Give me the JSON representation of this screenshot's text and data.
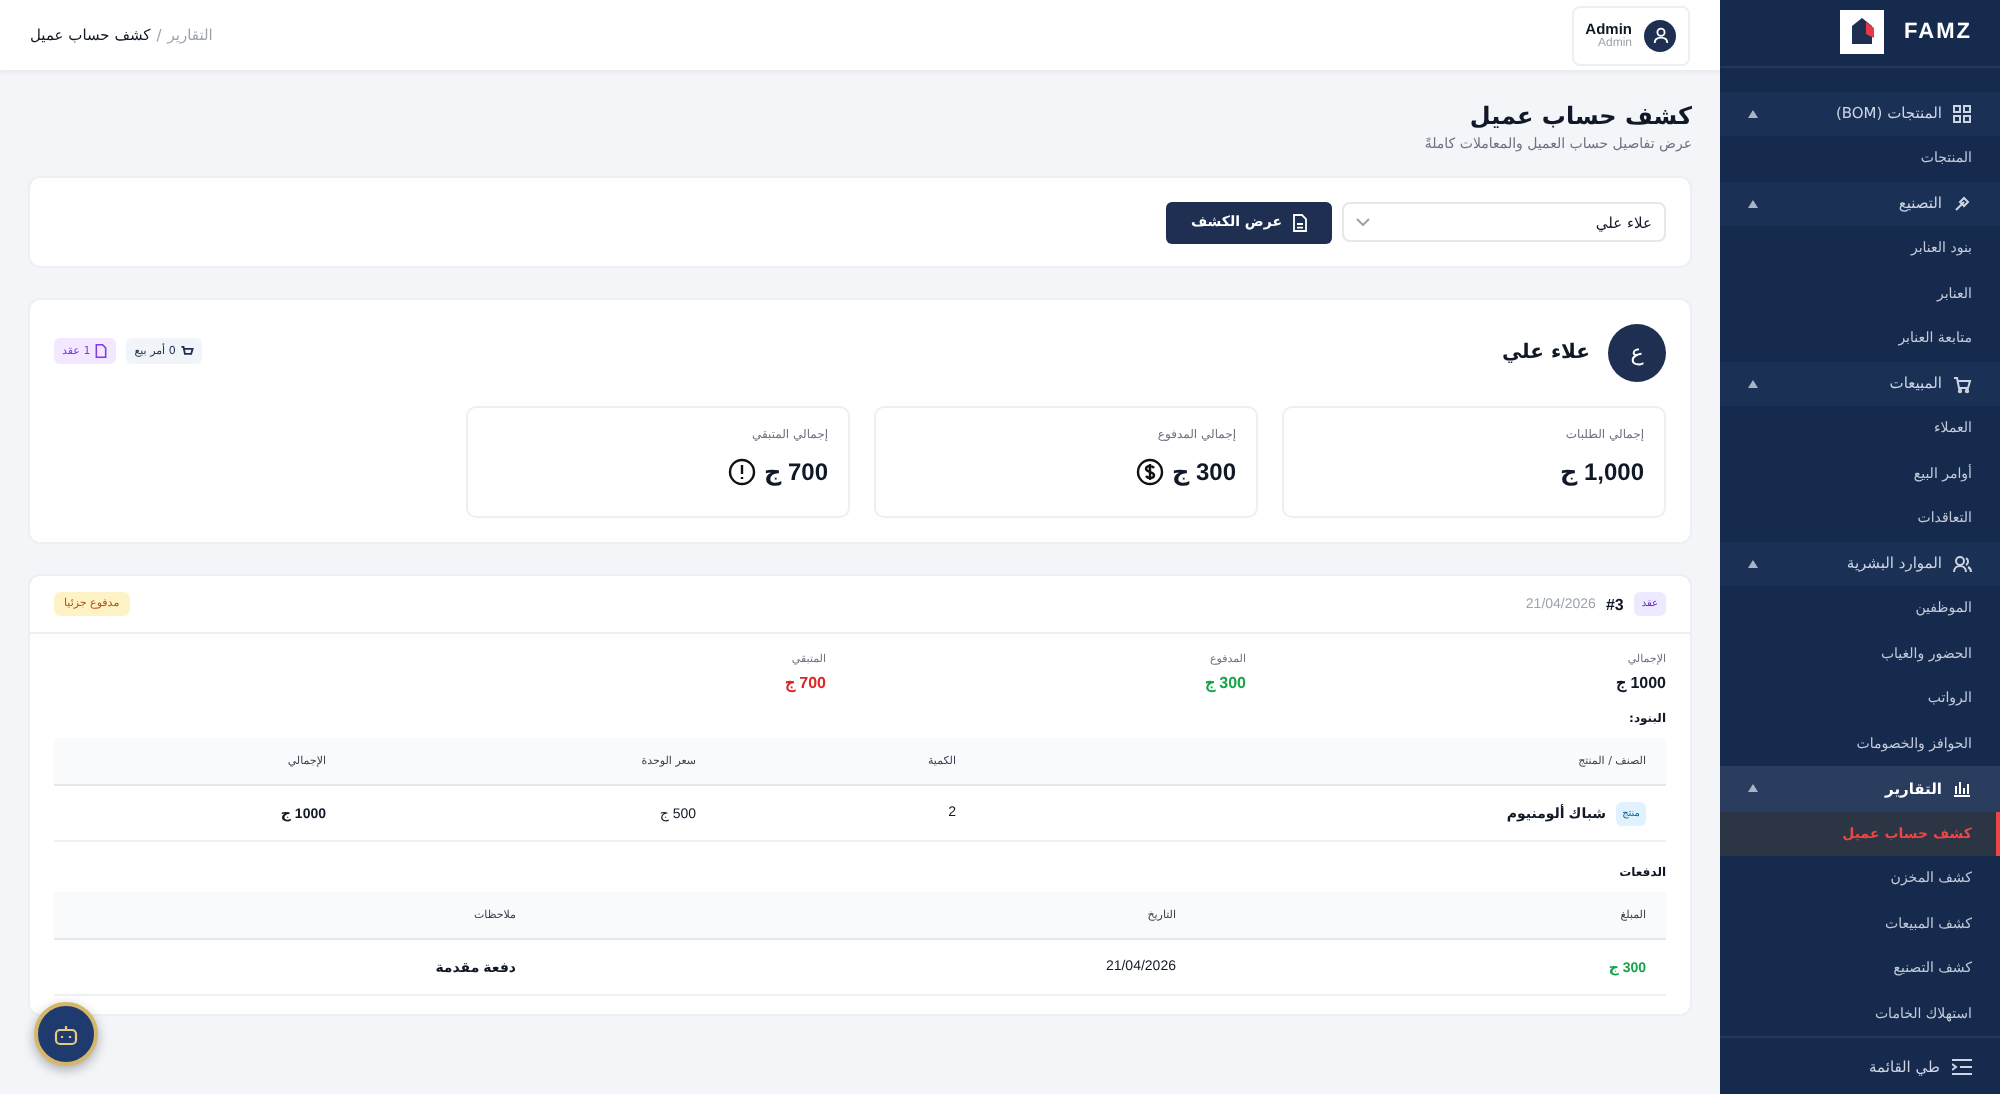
{
  "sidebar": {
    "logo": "FAMZ",
    "groups": [
      {
        "label": "المنتجات (BOM)",
        "expanded": true,
        "selected": false,
        "children": [
          {
            "label": "المنتجات",
            "selected": false
          }
        ]
      },
      {
        "label": "التصنيع",
        "expanded": true,
        "selected": false,
        "children": [
          {
            "label": "بنود العنابر",
            "selected": false
          },
          {
            "label": "العنابر",
            "selected": false
          },
          {
            "label": "متابعة العنابر",
            "selected": false
          }
        ]
      },
      {
        "label": "المبيعات",
        "expanded": true,
        "selected": false,
        "children": [
          {
            "label": "العملاء",
            "selected": false
          },
          {
            "label": "أوامر البيع",
            "selected": false
          },
          {
            "label": "التعاقدات",
            "selected": false
          }
        ]
      },
      {
        "label": "الموارد البشرية",
        "expanded": true,
        "selected": false,
        "children": [
          {
            "label": "الموظفين",
            "selected": false
          },
          {
            "label": "الحضور والغياب",
            "selected": false
          },
          {
            "label": "الرواتب",
            "selected": false
          },
          {
            "label": "الحوافز والخصومات",
            "selected": false
          }
        ]
      },
      {
        "label": "التقارير",
        "expanded": true,
        "selected": true,
        "children": [
          {
            "label": "كشف حساب عميل",
            "selected": true
          },
          {
            "label": "كشف المخزن",
            "selected": false
          },
          {
            "label": "كشف المبيعات",
            "selected": false
          },
          {
            "label": "كشف التصنيع",
            "selected": false
          },
          {
            "label": "استهلاك الخامات",
            "selected": false
          }
        ]
      }
    ],
    "collapse": "طي القائمة"
  },
  "header": {
    "breadcrumb_parent": "التقارير",
    "breadcrumb_separator": "/",
    "breadcrumb_current": "كشف حساب عميل",
    "user_name": "Admin",
    "user_role": "Admin"
  },
  "page": {
    "title": "كشف حساب عميل",
    "subtitle": "عرض تفاصيل حساب العميل والمعاملات كاملةً"
  },
  "filter": {
    "customer": "علاء علي",
    "button": "عرض الكشف"
  },
  "customer": {
    "initial": "ع",
    "name": "علاء علي",
    "badges": [
      "0 أمر بيع",
      "1 عقد"
    ],
    "stats": [
      {
        "label": "إجمالي الطلبات",
        "value": "1,000 ج",
        "kind": "plain"
      },
      {
        "label": "إجمالي المدفوع",
        "value": "300 ج",
        "kind": "paid"
      },
      {
        "label": "إجمالي المتبقي",
        "value": "700 ج",
        "kind": "due"
      }
    ]
  },
  "contract": {
    "tag": "عقد",
    "number": "#3",
    "date": "21/04/2026",
    "status": "مدفوع جزئيا",
    "totals": [
      {
        "label": "الإجمالي",
        "value": "1000 ج",
        "kind": "total"
      },
      {
        "label": "المدفوع",
        "value": "300 ج",
        "kind": "paid"
      },
      {
        "label": "المتبقي",
        "value": "700 ج",
        "kind": "due"
      }
    ],
    "items_title": "البنود:",
    "items_columns": [
      "الصنف / المنتج",
      "الكمية",
      "سعر الوحدة",
      "الإجمالي"
    ],
    "items": [
      {
        "type": "منتج",
        "name": "شباك ألومنيوم",
        "qty": "2",
        "unit_price": "500 ج",
        "total": "1000 ج"
      }
    ],
    "payments_title": "الدفعات",
    "payments_columns": [
      "المبلغ",
      "التاريخ",
      "ملاحظات"
    ],
    "payments": [
      {
        "amount": "300 ج",
        "date": "21/04/2026",
        "notes": "دفعة مقدمة"
      }
    ]
  }
}
